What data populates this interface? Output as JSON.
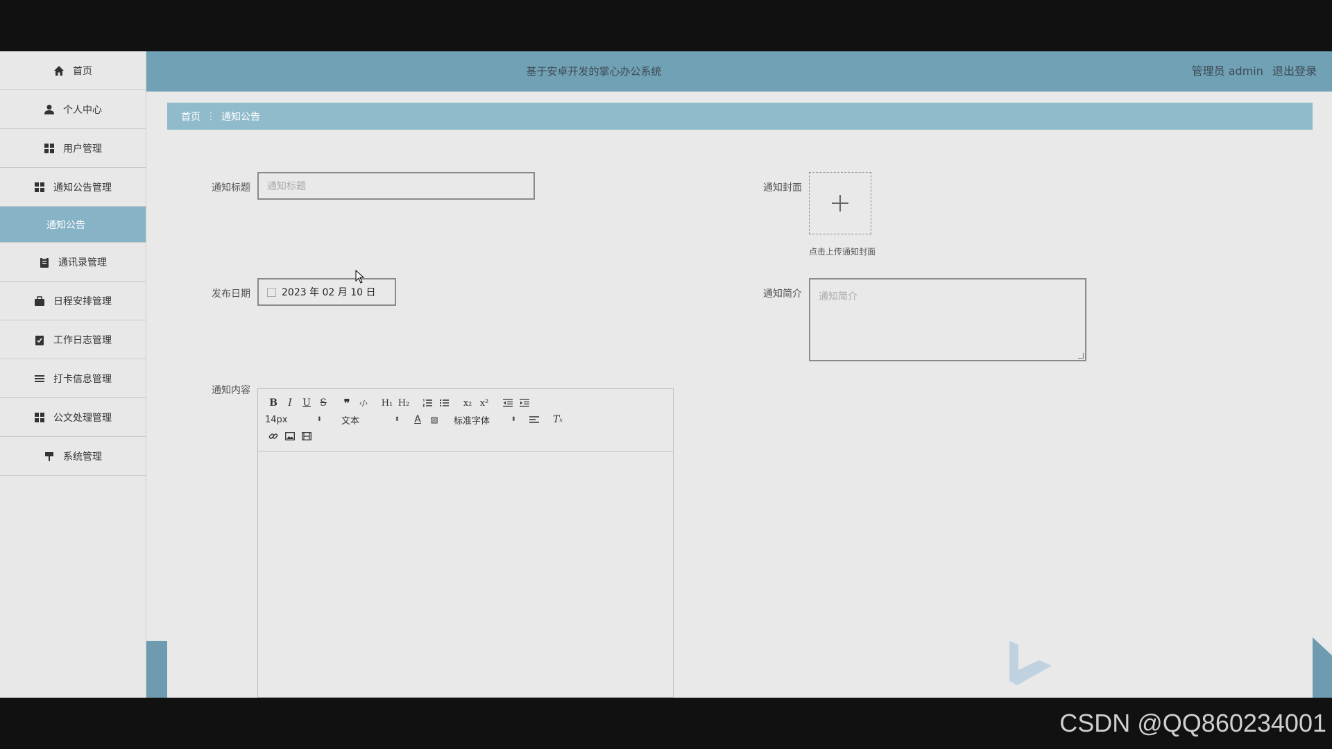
{
  "header": {
    "title": "基于安卓开发的掌心办公系统",
    "role": "管理员 admin",
    "logout": "退出登录"
  },
  "sidebar": {
    "items": [
      {
        "label": "首页",
        "icon": "home-icon"
      },
      {
        "label": "个人中心",
        "icon": "user-icon"
      },
      {
        "label": "用户管理",
        "icon": "grid-icon"
      },
      {
        "label": "通知公告管理",
        "icon": "grid-icon"
      },
      {
        "label": "通知公告",
        "icon": "",
        "active": true
      },
      {
        "label": "通讯录管理",
        "icon": "clipboard-icon"
      },
      {
        "label": "日程安排管理",
        "icon": "briefcase-icon"
      },
      {
        "label": "工作日志管理",
        "icon": "checklist-icon"
      },
      {
        "label": "打卡信息管理",
        "icon": "list-icon"
      },
      {
        "label": "公文处理管理",
        "icon": "grid-icon"
      },
      {
        "label": "系统管理",
        "icon": "sign-icon"
      }
    ]
  },
  "breadcrumb": {
    "home": "首页",
    "separator": "⋮",
    "current": "通知公告"
  },
  "form": {
    "title_label": "通知标题",
    "title_placeholder": "通知标题",
    "cover_label": "通知封面",
    "cover_hint": "点击上传通知封面",
    "date_label": "发布日期",
    "date_value": "2023 年 02 月 10 日",
    "intro_label": "通知简介",
    "intro_placeholder": "通知简介",
    "content_label": "通知内容"
  },
  "editor": {
    "font_size": "14px",
    "header_select": "文本",
    "font_family": "标准字体"
  },
  "watermark": "CSDN @QQ860234001",
  "colors": {
    "header_bg": "#71a1b5",
    "active_item_bg": "#86b3c6",
    "breadcrumb_bg": "#8fbbca",
    "content_bg": "#e9e9e9"
  }
}
